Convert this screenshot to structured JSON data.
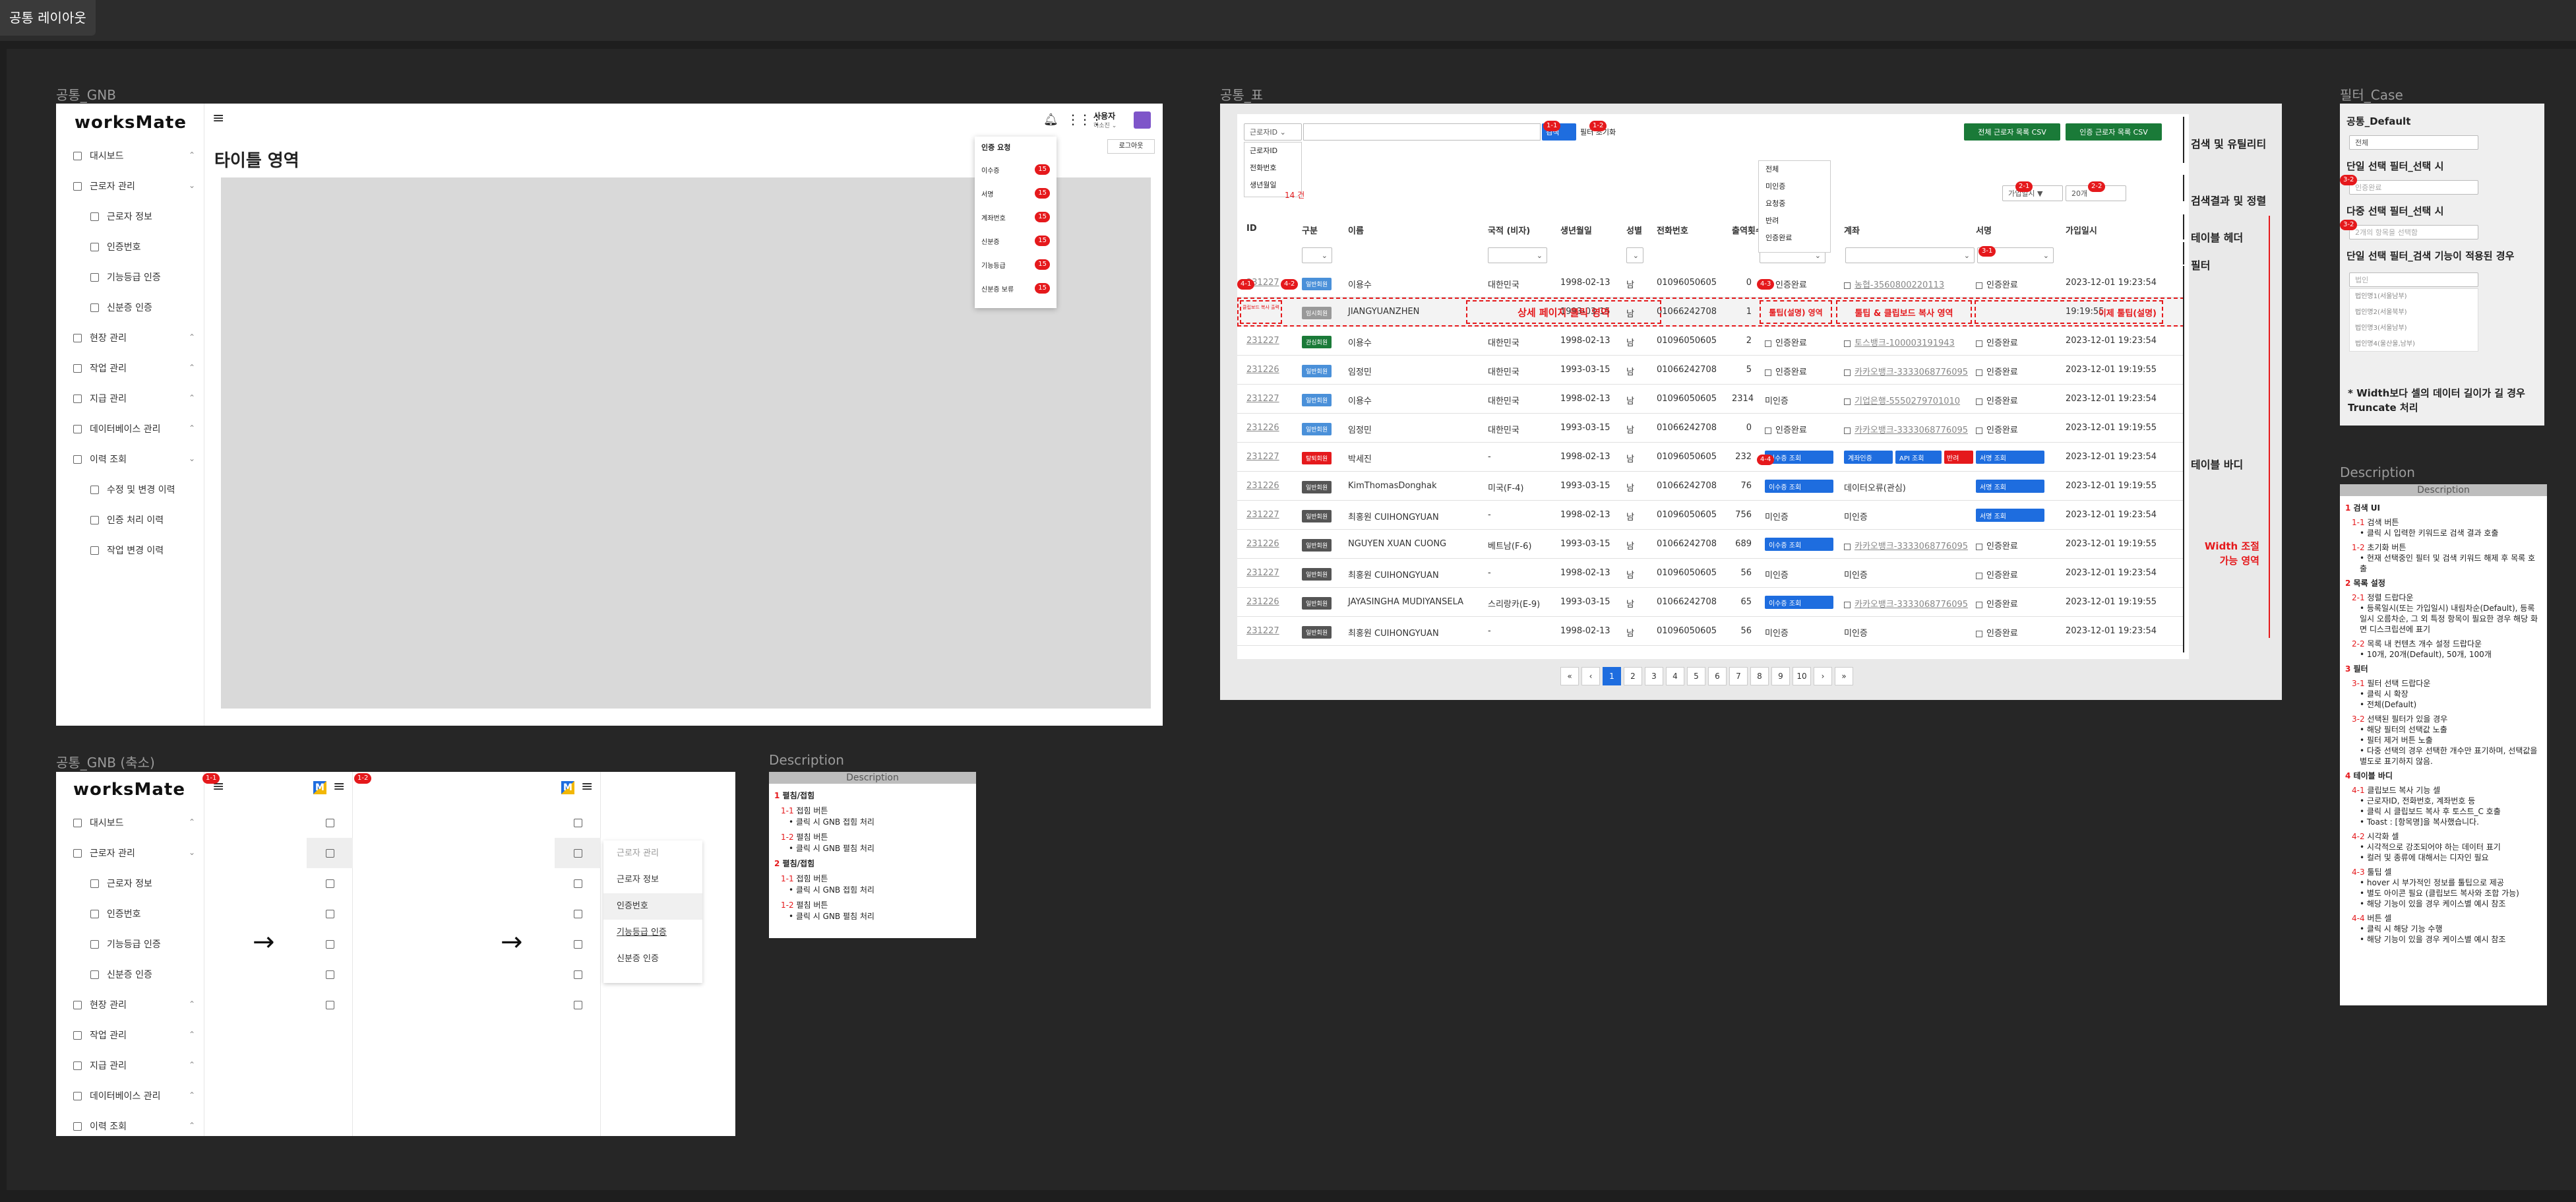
{
  "page_title": "공통 레이아웃",
  "frames": {
    "gnb": "공통_GNB",
    "gnb_collapse": "공통_GNB (축소)",
    "table": "공통_표",
    "filter_case": "필터_Case",
    "description": "Description"
  },
  "gnb": {
    "logo": "worksMate",
    "title": "타이틀 영역",
    "user_name": "사용자",
    "user_sub": "하소진 ⌄",
    "logout": "로그아웃",
    "menu": [
      {
        "label": "대시보드",
        "level": 0,
        "chev": "⌃"
      },
      {
        "label": "근로자 관리",
        "level": 0,
        "chev": "⌄"
      },
      {
        "label": "근로자 정보",
        "level": 1
      },
      {
        "label": "인증번호",
        "level": 1
      },
      {
        "label": "기능등급 인증",
        "level": 1
      },
      {
        "label": "신분증 인증",
        "level": 1
      },
      {
        "label": "현장 관리",
        "level": 0,
        "chev": "⌃"
      },
      {
        "label": "작업 관리",
        "level": 0,
        "chev": "⌃"
      },
      {
        "label": "지급 관리",
        "level": 0,
        "chev": "⌃"
      },
      {
        "label": "데이터베이스 관리",
        "level": 0,
        "chev": "⌃"
      },
      {
        "label": "이력 조회",
        "level": 0,
        "chev": "⌄"
      },
      {
        "label": "수정 및 변경 이력",
        "level": 1
      },
      {
        "label": "인증 처리 이력",
        "level": 1
      },
      {
        "label": "작업 변경 이력",
        "level": 1
      }
    ],
    "notif_title": "인증 요청",
    "notifs": [
      {
        "label": "이수증",
        "count": "15"
      },
      {
        "label": "서명",
        "count": "15"
      },
      {
        "label": "계좌번호",
        "count": "15"
      },
      {
        "label": "신분증",
        "count": "15"
      },
      {
        "label": "기능등급",
        "count": "15"
      },
      {
        "label": "신분증 보류",
        "count": "15"
      }
    ]
  },
  "gnb_collapse": {
    "menu": [
      {
        "label": "대시보드",
        "level": 0,
        "chev": "⌃"
      },
      {
        "label": "근로자 관리",
        "level": 0,
        "chev": "⌄"
      },
      {
        "label": "근로자 정보",
        "level": 1
      },
      {
        "label": "인증번호",
        "level": 1
      },
      {
        "label": "기능등급 인증",
        "level": 1
      },
      {
        "label": "신분증 인증",
        "level": 1
      },
      {
        "label": "현장 관리",
        "level": 0,
        "chev": "⌃"
      },
      {
        "label": "작업 관리",
        "level": 0,
        "chev": "⌃"
      },
      {
        "label": "지급 관리",
        "level": 0,
        "chev": "⌃"
      },
      {
        "label": "데이터베이스 관리",
        "level": 0,
        "chev": "⌃"
      },
      {
        "label": "이력 조회",
        "level": 0,
        "chev": "⌃"
      }
    ],
    "badge1": "1-1",
    "badge2": "1-2",
    "arrow": "→",
    "flyout": [
      "근로자 관리",
      "근로자 정보",
      "인증번호",
      "기능등급 인증",
      "신분증 인증"
    ]
  },
  "desc_small": {
    "header": "Description",
    "items": [
      {
        "num": "1",
        "title": "펼침/접힘",
        "subs": [
          {
            "code": "1-1",
            "title": "접힘 버튼",
            "bullet": "클릭 시 GNB 접힘 처리"
          },
          {
            "code": "1-2",
            "title": "펼침 버튼",
            "bullet": "클릭 시 GNB 펼침 처리"
          }
        ]
      },
      {
        "num": "2",
        "title": "펼침/접힘",
        "subs": [
          {
            "code": "1-1",
            "title": "접힘 버튼",
            "bullet": "클릭 시 GNB 접힘 처리"
          },
          {
            "code": "1-2",
            "title": "펼침 버튼",
            "bullet": "클릭 시 GNB 펼침 처리"
          }
        ]
      }
    ]
  },
  "table": {
    "search_select": "근로자ID ⌄",
    "search_options": [
      "근로자ID",
      "전화번호",
      "생년월일"
    ],
    "search_btn": "검색",
    "reset_btn": "필터 초기화",
    "csv_all": "전체 근로자 목록 CSV",
    "csv_cert": "인증 근로자 목록 CSV",
    "result_count": "14 건",
    "sort_select": "가입일시 ▼",
    "page_size": "20개",
    "status_options": [
      "전체",
      "미인증",
      "요청중",
      "반려",
      "인증완료"
    ],
    "headers": [
      "ID",
      "구분",
      "이름",
      "국적 (비자)",
      "생년월일",
      "성별",
      "전화번호",
      "출역횟수",
      "인증",
      "계좌",
      "서명",
      "가입일시"
    ],
    "rows": [
      {
        "id": "231227",
        "tag": "일반회원",
        "tagc": "#4a90d9",
        "name": "이용수",
        "nat": "대한민국",
        "birth": "1998-02-13",
        "sex": "남",
        "phone": "01096050605",
        "cnt": "0",
        "cert": "인증완료",
        "acct": "농협-3560800220113",
        "sign": "인증완료",
        "date": "2023-12-01 19:23:54"
      },
      {
        "id": "",
        "tag": "임시회원",
        "tagc": "#999",
        "name": "JIANGYUANZHEN",
        "nat": "",
        "birth": "1993-03-15",
        "sex": "남",
        "phone": "01066242708",
        "cnt": "1",
        "cert": "",
        "acct": "",
        "sign": "",
        "date": "19:19:55"
      },
      {
        "id": "231227",
        "tag": "관심회원",
        "tagc": "#1a7a38",
        "name": "이용수",
        "nat": "대한민국",
        "birth": "1998-02-13",
        "sex": "남",
        "phone": "01096050605",
        "cnt": "2",
        "cert": "인증완료",
        "acct": "토스뱅크-100003191943",
        "sign": "인증완료",
        "date": "2023-12-01 19:23:54"
      },
      {
        "id": "231226",
        "tag": "일반회원",
        "tagc": "#4a90d9",
        "name": "임정민",
        "nat": "대한민국",
        "birth": "1993-03-15",
        "sex": "남",
        "phone": "01066242708",
        "cnt": "5",
        "cert": "인증완료",
        "acct": "카카오뱅크-3333068776095",
        "sign": "인증완료",
        "date": "2023-12-01 19:19:55"
      },
      {
        "id": "231227",
        "tag": "일반회원",
        "tagc": "#4a90d9",
        "name": "이용수",
        "nat": "대한민국",
        "birth": "1998-02-13",
        "sex": "남",
        "phone": "01096050605",
        "cnt": "2314",
        "cert": "미인증",
        "acct": "기업은행-5550279701010",
        "sign": "인증완료",
        "date": "2023-12-01 19:23:54"
      },
      {
        "id": "231226",
        "tag": "일반회원",
        "tagc": "#4a90d9",
        "name": "임정민",
        "nat": "대한민국",
        "birth": "1993-03-15",
        "sex": "남",
        "phone": "01066242708",
        "cnt": "0",
        "cert": "인증완료",
        "acct": "카카오뱅크-3333068776095",
        "sign": "인증완료",
        "date": "2023-12-01 19:19:55"
      },
      {
        "id": "231227",
        "tag": "탈퇴회원",
        "tagc": "#e5191c",
        "name": "박세진",
        "nat": "-",
        "birth": "1998-02-13",
        "sex": "남",
        "phone": "01096050605",
        "cnt": "232",
        "cert": "이수증 조회",
        "acct": "",
        "sign": "서명 조회",
        "date": "2023-12-01 19:23:54"
      },
      {
        "id": "231226",
        "tag": "일반회원",
        "tagc": "#555",
        "name": "KimThomasDonghak",
        "nat": "미국(F-4)",
        "birth": "1993-03-15",
        "sex": "남",
        "phone": "01066242708",
        "cnt": "76",
        "cert": "이수증 조회",
        "acct": "데이터오류(관심)",
        "sign": "서명 조회",
        "date": "2023-12-01 19:19:55"
      },
      {
        "id": "231227",
        "tag": "일반회원",
        "tagc": "#555",
        "name": "최홍원 CUIHONGYUAN",
        "nat": "-",
        "birth": "1998-02-13",
        "sex": "남",
        "phone": "01096050605",
        "cnt": "756",
        "cert": "미인증",
        "acct": "미인증",
        "sign": "서명 조회",
        "date": "2023-12-01 19:23:54"
      },
      {
        "id": "231226",
        "tag": "일반회원",
        "tagc": "#555",
        "name": "NGUYEN XUAN CUONG",
        "nat": "베트남(F-6)",
        "birth": "1993-03-15",
        "sex": "남",
        "phone": "01066242708",
        "cnt": "689",
        "cert": "이수증 조회",
        "acct": "카카오뱅크-3333068776095",
        "sign": "인증완료",
        "date": "2023-12-01 19:19:55"
      },
      {
        "id": "231227",
        "tag": "일반회원",
        "tagc": "#555",
        "name": "최홍원 CUIHONGYUAN",
        "nat": "-",
        "birth": "1998-02-13",
        "sex": "남",
        "phone": "01096050605",
        "cnt": "56",
        "cert": "미인증",
        "acct": "미인증",
        "sign": "인증완료",
        "date": "2023-12-01 19:23:54"
      },
      {
        "id": "231226",
        "tag": "일반회원",
        "tagc": "#555",
        "name": "JAYASINGHA MUDIYANSELA",
        "nat": "스리랑카(E-9)",
        "birth": "1993-03-15",
        "sex": "남",
        "phone": "01066242708",
        "cnt": "65",
        "cert": "이수증 조회",
        "acct": "카카오뱅크-3333068776095",
        "sign": "인증완료",
        "date": "2023-12-01 19:19:55"
      },
      {
        "id": "231227",
        "tag": "일반회원",
        "tagc": "#555",
        "name": "최홍원 CUIHONGYUAN",
        "nat": "-",
        "birth": "1998-02-13",
        "sex": "남",
        "phone": "01096050605",
        "cnt": "56",
        "cert": "미인증",
        "acct": "미인증",
        "sign": "인증완료",
        "date": "2023-12-01 19:23:54"
      }
    ],
    "hover_row": {
      "copy_hint": "클립보드 복사 출력",
      "click_area": "상세 페이지 클릭 영역",
      "hover_cert": "툴팁(설명) 영역",
      "hover_acct": "툴팁 & 클립보드 복사 영역",
      "hover_sign": "이제 툴팁(설명)"
    },
    "extra_btns": [
      "계좌인증",
      "API 조회",
      "반려"
    ],
    "pages": [
      "«",
      "‹",
      "1",
      "2",
      "3",
      "4",
      "5",
      "6",
      "7",
      "8",
      "9",
      "10",
      "›",
      "»"
    ],
    "side_labels": [
      "검색 및 유틸리티",
      "검색결과 및 정렬",
      "테이블 헤더",
      "필터",
      "테이블 바디"
    ],
    "width_note": [
      "Width 조절",
      "가능 영역"
    ],
    "badges": [
      "1-1",
      "1-2",
      "2-1",
      "2-2",
      "3-1",
      "3-2",
      "4-1",
      "4-2",
      "4-3",
      "4-4"
    ]
  },
  "filter_case": {
    "c1_title": "공통_Default",
    "c1_value": "전체",
    "c2_title": "단일 선택 필터_선택 시",
    "c2_value": "인증완료",
    "c3_title": "다중 선택 필터_선택 시",
    "c3_value": "2개의 항목을 선택함",
    "c4_title": "단일 선택 필터_검색 기능이 적용된 경우",
    "c4_value": "법인",
    "c4_options": [
      "법인명1(서울남부)",
      "법인명2(서울북부)",
      "법인명3(서울남부)",
      "법인명4(울산울,남부)"
    ],
    "note": "* Width보다 셀의 데이터 길이가 길 경우 Truncate 처리",
    "badge": "3-2"
  },
  "desc_big": {
    "header": "Description",
    "items": [
      {
        "num": "1",
        "title": "검색 UI",
        "subs": [
          {
            "code": "1-1",
            "title": "검색 버튼",
            "bullets": [
              "클릭 시 입력한 키워드로 검색 결과 호출"
            ]
          },
          {
            "code": "1-2",
            "title": "초기화 버튼",
            "bullets": [
              "현재 선택중인 필터 및 검색 키워드 해제 후 목록 호출"
            ]
          }
        ]
      },
      {
        "num": "2",
        "title": "목록 설정",
        "subs": [
          {
            "code": "2-1",
            "title": "정렬 드랍다운",
            "bullets": [
              "등록일시(또는 가입일시) 내림차순(Default), 등록일시 오름차순, 그 외 특정 항목이 필요한 경우 해당 화면 디스크립션에 표기"
            ]
          },
          {
            "code": "2-2",
            "title": "목록 내 컨텐츠 개수 설정 드랍다운",
            "bullets": [
              "10개, 20개(Default), 50개, 100개"
            ]
          }
        ]
      },
      {
        "num": "3",
        "title": "필터",
        "subs": [
          {
            "code": "3-1",
            "title": "필터 선택 드랍다운",
            "bullets": [
              "클릭 시 확장",
              "전체(Default)"
            ]
          },
          {
            "code": "3-2",
            "title": "선택된 필터가 있을 경우",
            "bullets": [
              "해당 필터의 선택값 노출",
              "필터 제거 버튼 노출",
              "다중 선택의 경우 선택한 개수만 표기하며, 선택값을 별도로 표기하지 않음."
            ]
          }
        ]
      },
      {
        "num": "4",
        "title": "테이블 바디",
        "subs": [
          {
            "code": "4-1",
            "title": "클립보드 복사 기능 셀",
            "bullets": [
              "근로자ID, 전화번호, 계좌번호 등",
              "클릭 시 클립보드 복사 후 토스트_C 호출",
              "Toast : [항목명]을 복사했습니다."
            ]
          },
          {
            "code": "4-2",
            "title": "시각화 셀",
            "bullets": [
              "시각적으로 강조되어야 하는 데이터 표기",
              "컬러 및 종류에 대해서는 디자인 필요"
            ]
          },
          {
            "code": "4-3",
            "title": "툴팁 셀",
            "bullets": [
              "hover 시 부가적인 정보를 툴팁으로 제공",
              "별도 아이콘 필요 (클립보드 복사와 조합 가능)",
              "해당 기능이 있을 경우 케이스별 예시 참조"
            ]
          },
          {
            "code": "4-4",
            "title": "버튼 셀",
            "bullets": [
              "클릭 시 해당 기능 수행",
              "해당 기능이 있을 경우 케이스별 예시 참조"
            ]
          }
        ]
      }
    ]
  }
}
